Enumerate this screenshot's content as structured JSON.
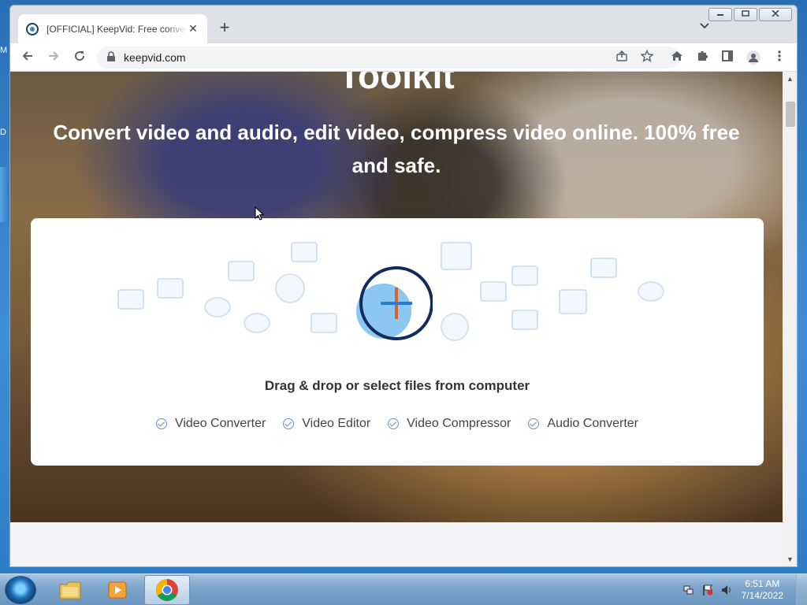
{
  "browser": {
    "tab_title": "[OFFICIAL] KeepVid: Free convert",
    "tab_close": "✕",
    "new_tab": "+",
    "url": "keepvid.com"
  },
  "page": {
    "hero_title_partial": "Toolkit",
    "hero_subtitle": "Convert video and audio, edit video, compress video online. 100% free and safe.",
    "drop_text": "Drag & drop or select files from computer",
    "features": [
      "Video Converter",
      "Video Editor",
      "Video Compressor",
      "Audio Converter"
    ]
  },
  "taskbar": {
    "time": "6:51 AM",
    "date": "7/14/2022"
  },
  "icons": {
    "back": "back-arrow-icon",
    "forward": "forward-arrow-icon",
    "reload": "reload-icon",
    "lock": "lock-icon",
    "share": "share-icon",
    "bookmark": "star-icon",
    "home": "home-icon",
    "extensions": "puzzle-icon",
    "side_panel": "side-panel-icon",
    "profile": "profile-icon",
    "menu": "kebab-menu-icon"
  },
  "colors": {
    "upload_ring": "#0f2c5c",
    "upload_plus": "#e0602a",
    "upload_fill": "#8cc6f2"
  }
}
